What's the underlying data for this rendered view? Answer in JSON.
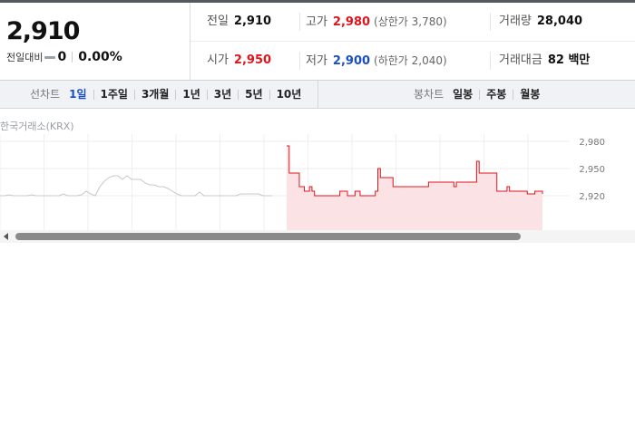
{
  "summary": {
    "price": "2,910",
    "change_label": "전일대비",
    "change_value": "0",
    "change_rate": "0.00%"
  },
  "stats": {
    "prev_close": {
      "label": "전일",
      "value": "2,910"
    },
    "high": {
      "label": "고가",
      "value": "2,980",
      "note": "(상한가 3,780)"
    },
    "volume": {
      "label": "거래량",
      "value": "28,040"
    },
    "open": {
      "label": "시가",
      "value": "2,950"
    },
    "low": {
      "label": "저가",
      "value": "2,900",
      "note": "(하한가 2,040)"
    },
    "trade_amount": {
      "label": "거래대금",
      "value": "82 백만"
    }
  },
  "line_tabs": {
    "label": "선차트",
    "items": [
      "1일",
      "1주일",
      "3개월",
      "1년",
      "3년",
      "5년",
      "10년"
    ],
    "active": "1일"
  },
  "candle_tabs": {
    "label": "봉차트",
    "items": [
      "일봉",
      "주봉",
      "월봉"
    ]
  },
  "source_label": "한국거래소(KRX)",
  "colors": {
    "up": "#e0151c",
    "down": "#1a4fc4",
    "chart_line": "#e0151c",
    "chart_fill": "#fbe3e5",
    "prior_line": "#c8c8c8"
  },
  "chart_data": {
    "type": "line",
    "yticks": [
      "2,980",
      "2,950",
      "2,920"
    ],
    "ylim": [
      2920,
      2990
    ],
    "grid": true,
    "prior_series": [
      2920,
      2920,
      2921,
      2920,
      2920,
      2920,
      2920,
      2921,
      2920,
      2920,
      2920,
      2920,
      2920,
      2920,
      2922,
      2920,
      2920,
      2920,
      2921,
      2925,
      2922,
      2920,
      2930,
      2936,
      2940,
      2942,
      2942,
      2938,
      2942,
      2938,
      2938,
      2938,
      2934,
      2932,
      2932,
      2930,
      2930,
      2928,
      2925,
      2922,
      2920,
      2920,
      2920,
      2920,
      2924,
      2920,
      2920,
      2920,
      2920,
      2920,
      2920,
      2920,
      2920,
      2922,
      2922,
      2922,
      2922,
      2922,
      2920,
      2920,
      2920
    ],
    "series": [
      2975,
      2945,
      2945,
      2945,
      2945,
      2930,
      2930,
      2925,
      2925,
      2930,
      2925,
      2920,
      2920,
      2920,
      2920,
      2920,
      2920,
      2920,
      2920,
      2920,
      2920,
      2925,
      2925,
      2925,
      2920,
      2920,
      2920,
      2925,
      2925,
      2920,
      2920,
      2920,
      2920,
      2920,
      2920,
      2925,
      2950,
      2940,
      2940,
      2940,
      2940,
      2940,
      2930,
      2930,
      2930,
      2930,
      2930,
      2930,
      2930,
      2930,
      2930,
      2930,
      2930,
      2930,
      2930,
      2930,
      2935,
      2935,
      2935,
      2935,
      2935,
      2935,
      2935,
      2935,
      2935,
      2935,
      2930,
      2935,
      2935,
      2935,
      2935,
      2935,
      2935,
      2935,
      2935,
      2958,
      2945,
      2945,
      2945,
      2945,
      2945,
      2945,
      2945,
      2925,
      2925,
      2925,
      2925,
      2930,
      2925,
      2925,
      2925,
      2925,
      2925,
      2925,
      2925,
      2922,
      2922,
      2922,
      2925,
      2925,
      2925,
      2922
    ]
  }
}
